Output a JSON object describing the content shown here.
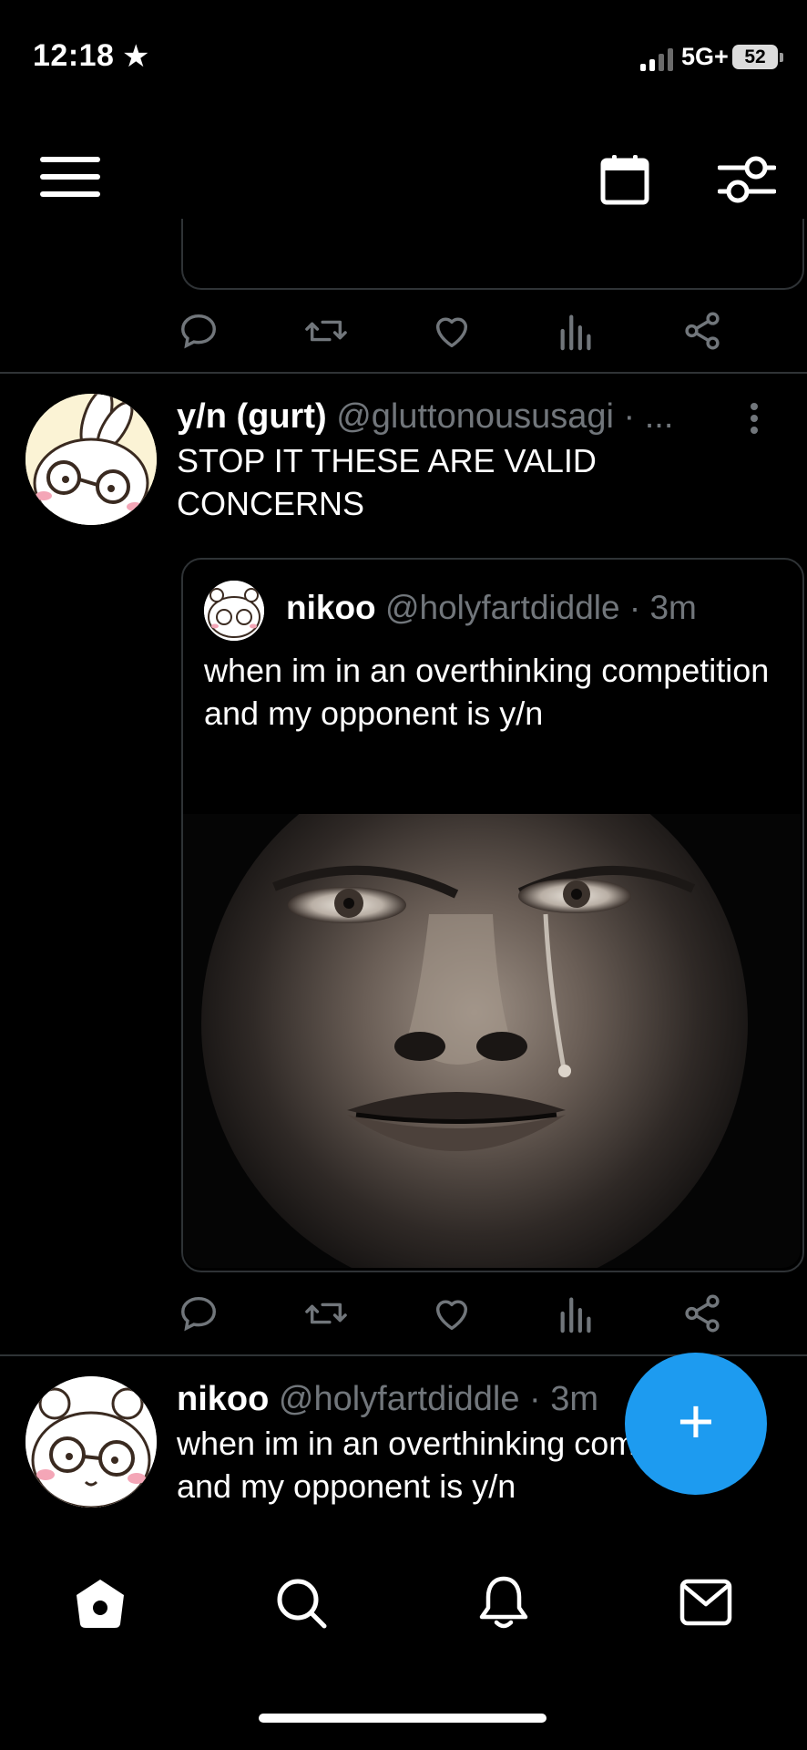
{
  "status_bar": {
    "time": "12:18",
    "network": "5G+",
    "battery": "52"
  },
  "top_post_fragment": {
    "actions": [
      "reply-icon",
      "retweet-icon",
      "like-icon",
      "views-icon",
      "share-icon"
    ]
  },
  "post": {
    "author_name": "y/n (gurt)",
    "author_handle": "@gluttonoususagi · ...",
    "text": "STOP IT THESE ARE VALID CONCERNS",
    "quote": {
      "author_name": "nikoo",
      "author_handle": "@holyfartdiddle · 3m",
      "text": "when im in an overthinking competition and my opponent is y/n"
    }
  },
  "next_post": {
    "author_name": "nikoo",
    "author_handle": "@holyfartdiddle · 3m",
    "text": "when im in an overthinking competition and my opponent is y/n"
  },
  "fab": {
    "label": "+"
  },
  "tab_bar": {
    "items": [
      "home-icon",
      "search-icon",
      "notifications-icon",
      "messages-icon"
    ]
  },
  "colors": {
    "background": "#000000",
    "accent": "#1d9bf0",
    "muted": "#71767b",
    "divider": "#2f3336"
  }
}
